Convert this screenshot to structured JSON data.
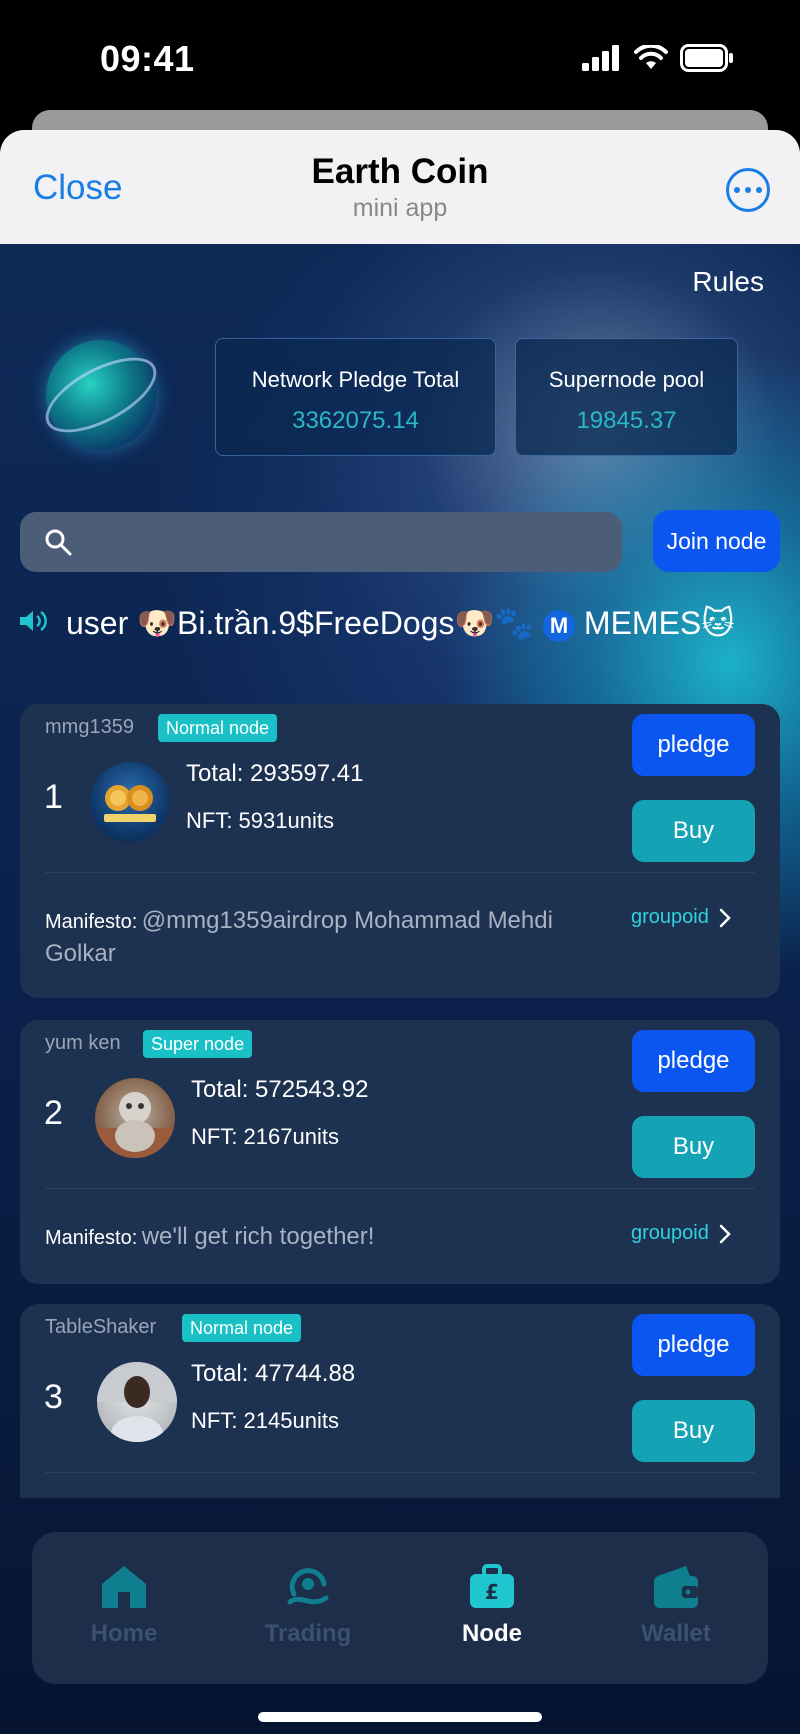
{
  "status_bar": {
    "time": "09:41"
  },
  "header": {
    "close_label": "Close",
    "title": "Earth Coin",
    "subtitle": "mini app"
  },
  "hero": {
    "rules_label": "Rules",
    "pledge_total_label": "Network Pledge Total",
    "pledge_total_value": "3362075.14",
    "pool_label": "Supernode pool",
    "pool_value": "19845.37"
  },
  "search": {
    "placeholder": "",
    "join_label": "Join node"
  },
  "marquee": {
    "text_before": "user 🐶Bi.trần.9$FreeDogs🐶🐾 ",
    "badge": "M",
    "text_after": " MEMES🐱"
  },
  "nodes": [
    {
      "username": "mmg1359",
      "badge": "Normal node",
      "rank": "1",
      "total": "Total: 293597.41",
      "nft": "NFT: 5931units",
      "pledge_label": "pledge",
      "buy_label": "Buy",
      "manifesto_label": "Manifesto:",
      "manifesto_text": "@mmg1359airdrop Mohammad Mehdi Golkar",
      "group_label": "groupoid"
    },
    {
      "username": "yum ken",
      "badge": "Super node",
      "rank": "2",
      "total": "Total: 572543.92",
      "nft": "NFT: 2167units",
      "pledge_label": "pledge",
      "buy_label": "Buy",
      "manifesto_label": "Manifesto:",
      "manifesto_text": "we'll get rich together!",
      "group_label": "groupoid"
    },
    {
      "username": "TableShaker",
      "badge": "Normal node",
      "rank": "3",
      "total": "Total: 47744.88",
      "nft": "NFT: 2145units",
      "pledge_label": "pledge",
      "buy_label": "Buy"
    }
  ],
  "nav": {
    "items": [
      {
        "label": "Home",
        "icon": "home-icon",
        "active": false
      },
      {
        "label": "Trading",
        "icon": "trading-icon",
        "active": false
      },
      {
        "label": "Node",
        "icon": "node-bag-icon",
        "active": true
      },
      {
        "label": "Wallet",
        "icon": "wallet-icon",
        "active": false
      }
    ]
  },
  "colors": {
    "accent_blue": "#0b55f0",
    "teal": "#14a3b4",
    "badge_teal": "#19c0c6",
    "link_teal": "#2fd2de",
    "ios_blue": "#1a7de6"
  }
}
